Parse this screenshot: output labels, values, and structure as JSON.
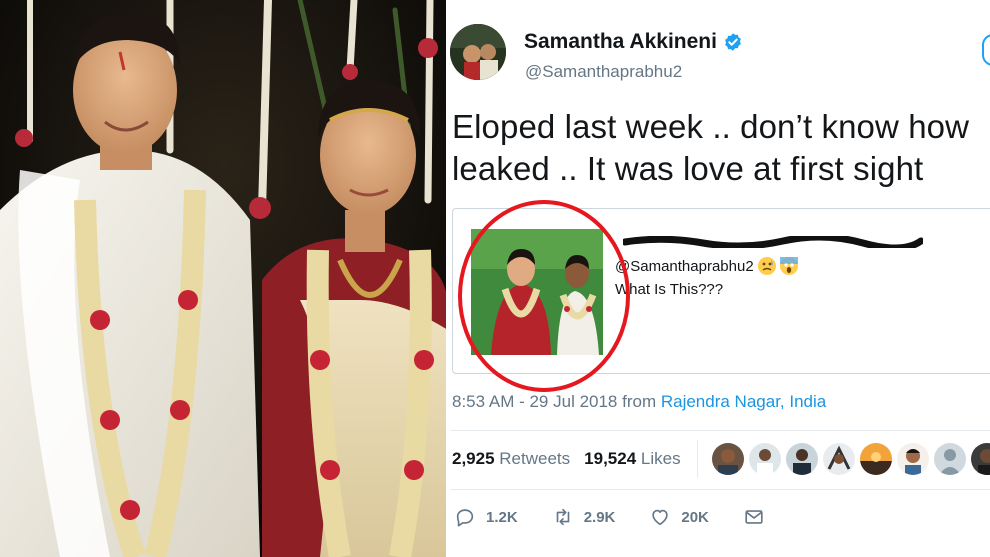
{
  "tweet": {
    "author_name": "Samantha Akkineni",
    "verified_icon": "verified-badge-icon",
    "handle": "@Samanthaprabhu2",
    "text_line1": "Eloped last week .. don’t know how",
    "text_line2": "leaked .. It was love at first sight",
    "quoted": {
      "handle": "@Samanthaprabhu2",
      "emojis": [
        "anxious-face-icon",
        "screaming-face-icon"
      ],
      "body": "What Is This???"
    },
    "timestamp": "8:53 AM - 29 Jul 2018 from ",
    "location": "Rajendra Nagar, India",
    "retweets_count": "2,925",
    "retweets_label": "Retweets",
    "likes_count": "19,524",
    "likes_label": "Likes",
    "liker_avatar_count": 8,
    "actions": {
      "reply_count": "1.2K",
      "retweet_count": "2.9K",
      "like_count": "20K"
    }
  },
  "colors": {
    "text_primary": "#14171a",
    "text_secondary": "#657786",
    "link_blue": "#1b95e0",
    "verified_blue": "#1da1f2",
    "highlight_red": "#e5171f",
    "border": "#e6ecf0"
  }
}
